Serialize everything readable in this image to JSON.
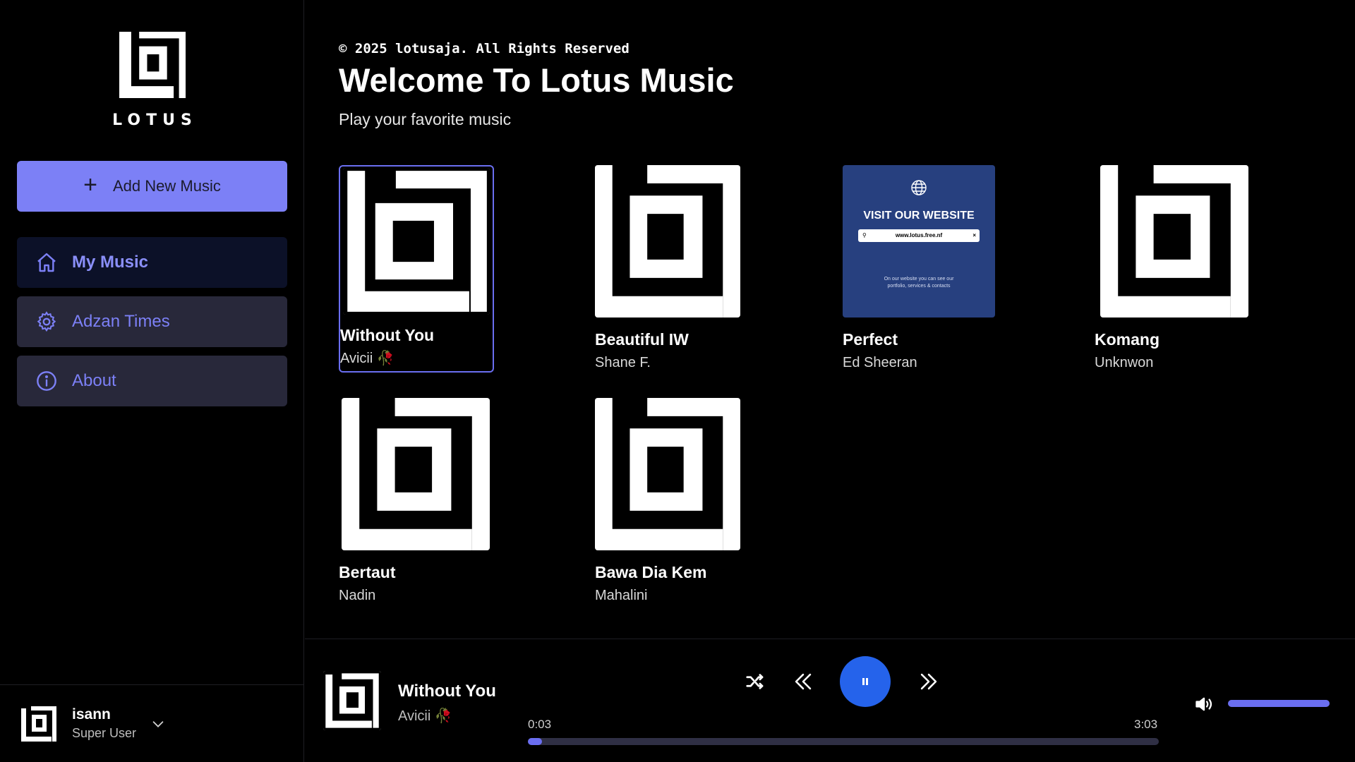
{
  "app": {
    "logo_text": "LOTUS"
  },
  "sidebar": {
    "add_button": "Add New Music",
    "items": [
      {
        "label": "My Music",
        "icon": "home-icon",
        "active": true
      },
      {
        "label": "Adzan Times",
        "icon": "gear-icon",
        "active": false
      },
      {
        "label": "About",
        "icon": "info-icon",
        "active": false
      }
    ]
  },
  "user": {
    "name": "isann",
    "role": "Super User"
  },
  "header": {
    "copyright": "© 2025 lotusaja. All Rights Reserved",
    "title": "Welcome To Lotus Music",
    "subtitle": "Play your favorite music"
  },
  "songs": [
    {
      "title": "Without You",
      "artist": "Avicii 🥀",
      "cover": "lotus-logo",
      "selected": true
    },
    {
      "title": "Beautiful IW",
      "artist": "Shane F.",
      "cover": "lotus-logo",
      "selected": false
    },
    {
      "title": "Perfect",
      "artist": "Ed Sheeran",
      "cover": "website-ad",
      "selected": false
    },
    {
      "title": "Komang",
      "artist": "Unknwon",
      "cover": "lotus-logo",
      "selected": false
    },
    {
      "title": "Bertaut",
      "artist": "Nadin",
      "cover": "lotus-logo",
      "selected": false
    },
    {
      "title": "Bawa Dia Kem",
      "artist": "Mahalini",
      "cover": "lotus-logo",
      "selected": false
    }
  ],
  "ad_cover": {
    "heading": "VISIT OUR WEBSITE",
    "url": "www.lotus.free.nf",
    "close": "×",
    "footer_line1": "On our website you can see our",
    "footer_line2": "portfolio, services & contacts"
  },
  "player": {
    "title": "Without You",
    "artist": "Avicii 🥀",
    "current_time": "0:03",
    "duration": "3:03",
    "progress": 0.0165,
    "volume": 1.0,
    "state": "playing"
  },
  "colors": {
    "accent": "#7c80f6",
    "play": "#2563eb",
    "nav_bg": "#28283a",
    "nav_active_bg": "#0c1128",
    "ad_bg": "#27407f"
  }
}
